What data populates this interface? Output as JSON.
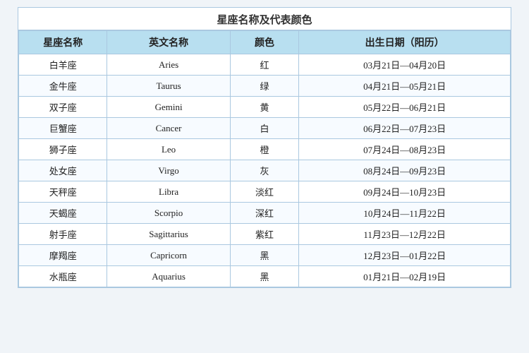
{
  "title": "星座名称及代表颜色",
  "headers": [
    "星座名称",
    "英文名称",
    "颜色",
    "出生日期（阳历）"
  ],
  "rows": [
    {
      "chinese": "白羊座",
      "english": "Aries",
      "color": "红",
      "date": "03月21日—04月20日"
    },
    {
      "chinese": "金牛座",
      "english": "Taurus",
      "color": "绿",
      "date": "04月21日—05月21日"
    },
    {
      "chinese": "双子座",
      "english": "Gemini",
      "color": "黄",
      "date": "05月22日—06月21日"
    },
    {
      "chinese": "巨蟹座",
      "english": "Cancer",
      "color": "白",
      "date": "06月22日—07月23日"
    },
    {
      "chinese": "狮子座",
      "english": "Leo",
      "color": "橙",
      "date": "07月24日—08月23日"
    },
    {
      "chinese": "处女座",
      "english": "Virgo",
      "color": "灰",
      "date": "08月24日—09月23日"
    },
    {
      "chinese": "天秤座",
      "english": "Libra",
      "color": "淡红",
      "date": "09月24日—10月23日"
    },
    {
      "chinese": "天蝎座",
      "english": "Scorpio",
      "color": "深红",
      "date": "10月24日—11月22日"
    },
    {
      "chinese": "射手座",
      "english": "Sagittarius",
      "color": "紫红",
      "date": "11月23日—12月22日"
    },
    {
      "chinese": "摩羯座",
      "english": "Capricorn",
      "color": "黑",
      "date": "12月23日—01月22日"
    },
    {
      "chinese": "水瓶座",
      "english": "Aquarius",
      "color": "黑",
      "date": "01月21日—02月19日"
    }
  ]
}
